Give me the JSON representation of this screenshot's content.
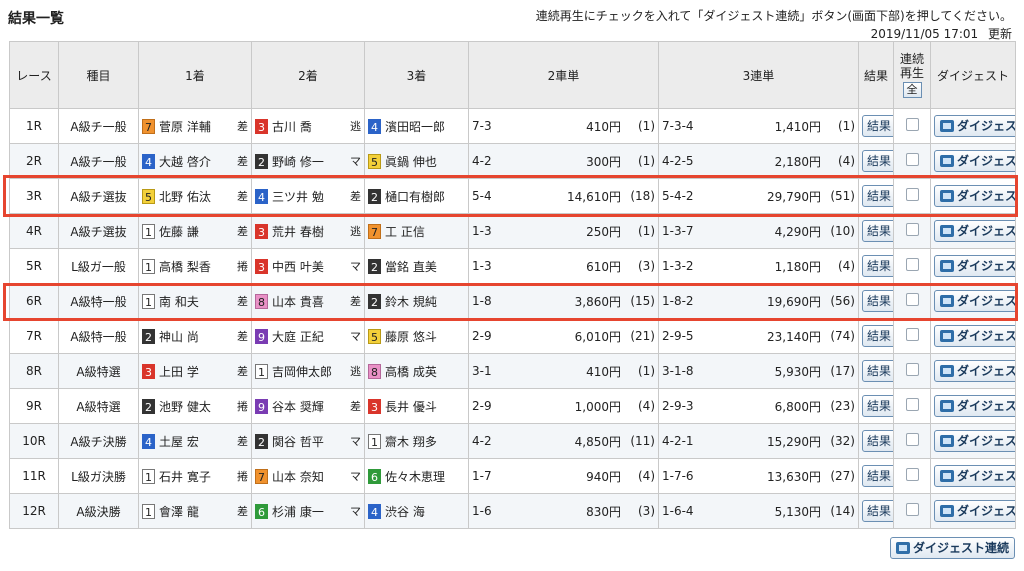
{
  "page_title": "結果一覧",
  "instruction": "連続再生にチェックを入れて「ダイジェスト連続」ボタン(画面下部)を押してください。",
  "timestamp": "2019/11/05 17:01",
  "refresh_label": "更新",
  "columns": {
    "race": "レース",
    "type": "種目",
    "first": "1着",
    "second": "2着",
    "third": "3着",
    "exacta2": "2車単",
    "trifecta3": "3連単",
    "result": "結果",
    "continuous_line1": "連続",
    "continuous_line2": "再生",
    "all": "全",
    "digest": "ダイジェスト"
  },
  "result_button_label": "結果",
  "digest_button_label": "ダイジェスト",
  "continuous_digest_label": "ダイジェスト連続",
  "yen": "円",
  "highlight_color": "#e6452f",
  "races": [
    {
      "race": "1R",
      "type": "A級チ一般",
      "first": {
        "frame": "7",
        "name": "菅原 洋輔",
        "tactic": "差"
      },
      "second": {
        "frame": "3",
        "name": "古川 喬",
        "tactic": "逃"
      },
      "third": {
        "frame": "4",
        "name": "濱田昭一郎"
      },
      "ex_combo": "7-3",
      "ex_amt": "410円",
      "ex_pop": "(1)",
      "tri_combo": "7-3-4",
      "tri_amt": "1,410円",
      "tri_pop": "(1)"
    },
    {
      "race": "2R",
      "type": "A級チ一般",
      "first": {
        "frame": "4",
        "name": "大越 啓介",
        "tactic": "差"
      },
      "second": {
        "frame": "2",
        "name": "野崎 修一",
        "tactic": "マ"
      },
      "third": {
        "frame": "5",
        "name": "眞鍋 伸也"
      },
      "ex_combo": "4-2",
      "ex_amt": "300円",
      "ex_pop": "(1)",
      "tri_combo": "4-2-5",
      "tri_amt": "2,180円",
      "tri_pop": "(4)"
    },
    {
      "race": "3R",
      "type": "A級チ選抜",
      "first": {
        "frame": "5",
        "name": "北野 佑汰",
        "tactic": "差"
      },
      "second": {
        "frame": "4",
        "name": "三ツ井 勉",
        "tactic": "差"
      },
      "third": {
        "frame": "2",
        "name": "樋口有樹郎"
      },
      "ex_combo": "5-4",
      "ex_amt": "14,610円",
      "ex_pop": "(18)",
      "tri_combo": "5-4-2",
      "tri_amt": "29,790円",
      "tri_pop": "(51)"
    },
    {
      "race": "4R",
      "type": "A級チ選抜",
      "first": {
        "frame": "1",
        "name": "佐藤 謙",
        "tactic": "差"
      },
      "second": {
        "frame": "3",
        "name": "荒井 春樹",
        "tactic": "逃"
      },
      "third": {
        "frame": "7",
        "name": "工 正信"
      },
      "ex_combo": "1-3",
      "ex_amt": "250円",
      "ex_pop": "(1)",
      "tri_combo": "1-3-7",
      "tri_amt": "4,290円",
      "tri_pop": "(10)"
    },
    {
      "race": "5R",
      "type": "L級ガ一般",
      "first": {
        "frame": "1",
        "name": "高橋 梨香",
        "tactic": "捲"
      },
      "second": {
        "frame": "3",
        "name": "中西 叶美",
        "tactic": "マ"
      },
      "third": {
        "frame": "2",
        "name": "當銘 直美"
      },
      "ex_combo": "1-3",
      "ex_amt": "610円",
      "ex_pop": "(3)",
      "tri_combo": "1-3-2",
      "tri_amt": "1,180円",
      "tri_pop": "(4)"
    },
    {
      "race": "6R",
      "type": "A級特一般",
      "first": {
        "frame": "1",
        "name": "南 和夫",
        "tactic": "差"
      },
      "second": {
        "frame": "8",
        "name": "山本 貴喜",
        "tactic": "差"
      },
      "third": {
        "frame": "2",
        "name": "鈴木 規純"
      },
      "ex_combo": "1-8",
      "ex_amt": "3,860円",
      "ex_pop": "(15)",
      "tri_combo": "1-8-2",
      "tri_amt": "19,690円",
      "tri_pop": "(56)"
    },
    {
      "race": "7R",
      "type": "A級特一般",
      "first": {
        "frame": "2",
        "name": "神山 尚",
        "tactic": "差"
      },
      "second": {
        "frame": "9",
        "name": "大庭 正紀",
        "tactic": "マ"
      },
      "third": {
        "frame": "5",
        "name": "藤原 悠斗"
      },
      "ex_combo": "2-9",
      "ex_amt": "6,010円",
      "ex_pop": "(21)",
      "tri_combo": "2-9-5",
      "tri_amt": "23,140円",
      "tri_pop": "(74)"
    },
    {
      "race": "8R",
      "type": "A級特選",
      "first": {
        "frame": "3",
        "name": "上田 学",
        "tactic": "差"
      },
      "second": {
        "frame": "1",
        "name": "吉岡伸太郎",
        "tactic": "逃"
      },
      "third": {
        "frame": "8",
        "name": "高橋 成英"
      },
      "ex_combo": "3-1",
      "ex_amt": "410円",
      "ex_pop": "(1)",
      "tri_combo": "3-1-8",
      "tri_amt": "5,930円",
      "tri_pop": "(17)"
    },
    {
      "race": "9R",
      "type": "A級特選",
      "first": {
        "frame": "2",
        "name": "池野 健太",
        "tactic": "捲"
      },
      "second": {
        "frame": "9",
        "name": "谷本 奨輝",
        "tactic": "差"
      },
      "third": {
        "frame": "3",
        "name": "長井 優斗"
      },
      "ex_combo": "2-9",
      "ex_amt": "1,000円",
      "ex_pop": "(4)",
      "tri_combo": "2-9-3",
      "tri_amt": "6,800円",
      "tri_pop": "(23)"
    },
    {
      "race": "10R",
      "type": "A級チ決勝",
      "first": {
        "frame": "4",
        "name": "土屋 宏",
        "tactic": "差"
      },
      "second": {
        "frame": "2",
        "name": "関谷 哲平",
        "tactic": "マ"
      },
      "third": {
        "frame": "1",
        "name": "齋木 翔多"
      },
      "ex_combo": "4-2",
      "ex_amt": "4,850円",
      "ex_pop": "(11)",
      "tri_combo": "4-2-1",
      "tri_amt": "15,290円",
      "tri_pop": "(32)"
    },
    {
      "race": "11R",
      "type": "L級ガ決勝",
      "first": {
        "frame": "1",
        "name": "石井 寛子",
        "tactic": "捲"
      },
      "second": {
        "frame": "7",
        "name": "山本 奈知",
        "tactic": "マ"
      },
      "third": {
        "frame": "6",
        "name": "佐々木恵理"
      },
      "ex_combo": "1-7",
      "ex_amt": "940円",
      "ex_pop": "(4)",
      "tri_combo": "1-7-6",
      "tri_amt": "13,630円",
      "tri_pop": "(27)"
    },
    {
      "race": "12R",
      "type": "A級決勝",
      "first": {
        "frame": "1",
        "name": "會澤 龍",
        "tactic": "差"
      },
      "second": {
        "frame": "6",
        "name": "杉浦 康一",
        "tactic": "マ"
      },
      "third": {
        "frame": "4",
        "name": "渋谷 海"
      },
      "ex_combo": "1-6",
      "ex_amt": "830円",
      "ex_pop": "(3)",
      "tri_combo": "1-6-4",
      "tri_amt": "5,130円",
      "tri_pop": "(14)"
    }
  ]
}
